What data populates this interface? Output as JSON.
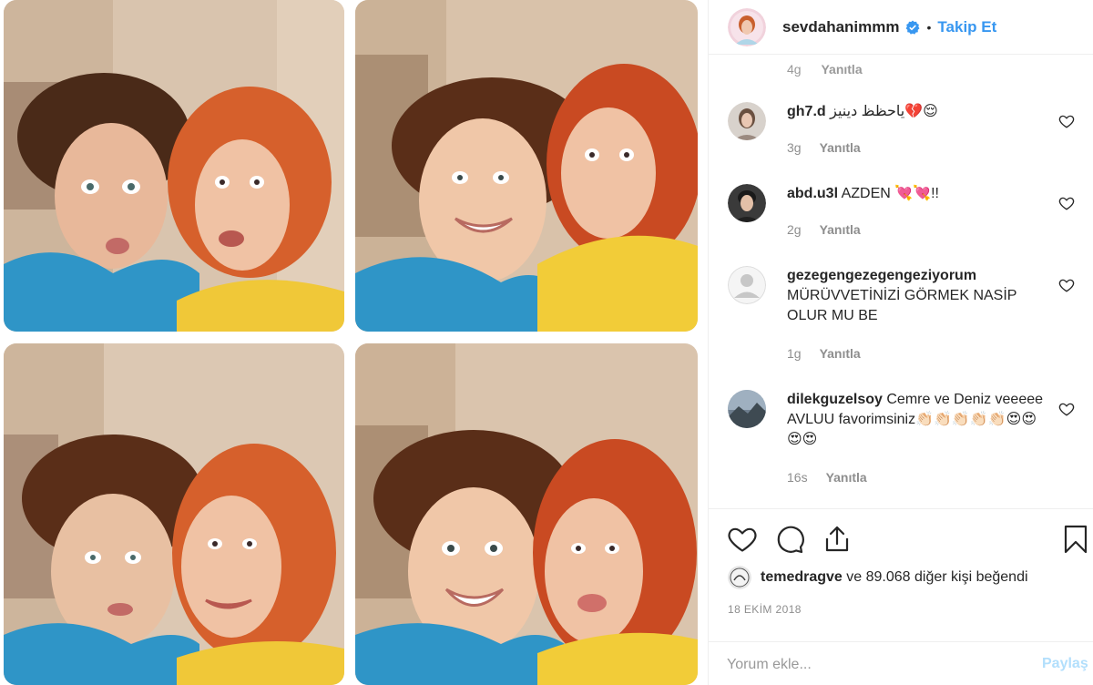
{
  "header": {
    "username": "sevdahanimmm",
    "separator": "•",
    "follow_label": "Takip Et"
  },
  "partial_comment": {
    "age": "4g",
    "reply_label": "Yanıtla"
  },
  "comments": [
    {
      "user": "gh7.d",
      "text": "ياحظظ دينيز💔😌",
      "age": "3g",
      "reply_label": "Yanıtla"
    },
    {
      "user": "abd.u3l",
      "text": "AZDEN 💘💘!!",
      "age": "2g",
      "reply_label": "Yanıtla"
    },
    {
      "user": "gezegengezegengeziyorum",
      "text": "MÜRÜVVETİNİZİ GÖRMEK NASİP OLUR MU BE",
      "age": "1g",
      "reply_label": "Yanıtla"
    },
    {
      "user": "dilekguzelsoy",
      "text": "Cemre ve Deniz veeeee AVLUU favorimsiniz👏🏻👏🏻👏🏻👏🏻👏🏻😍😍😍😍",
      "age": "16s",
      "reply_label": "Yanıtla"
    }
  ],
  "actions": {
    "icons": [
      "heart-icon",
      "comment-icon",
      "share-icon",
      "bookmark-icon"
    ]
  },
  "likes": {
    "user": "temedragve",
    "text": "ve 89.068 diğer kişi beğendi"
  },
  "date": "18 EKİM 2018",
  "composer": {
    "placeholder": "Yorum ekle...",
    "post_label": "Paylaş"
  },
  "colors": {
    "accent": "#3897f0",
    "text": "#262626",
    "muted": "#8e8e8e",
    "post_disabled": "#b2dffc"
  }
}
